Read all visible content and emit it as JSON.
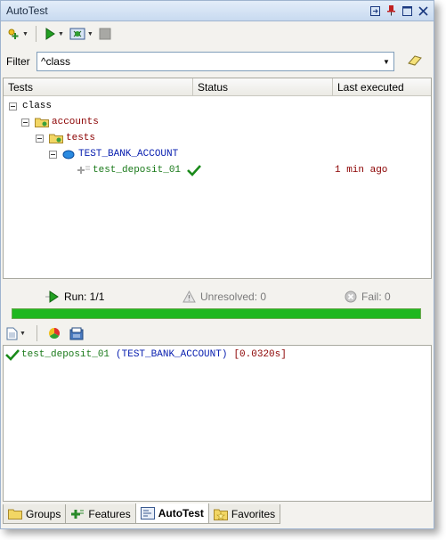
{
  "window": {
    "title": "AutoTest"
  },
  "filter": {
    "label": "Filter",
    "value": "^class"
  },
  "tree": {
    "columns": [
      "Tests",
      "Status",
      "Last executed"
    ],
    "rows": [
      {
        "label": "class"
      },
      {
        "label": "accounts"
      },
      {
        "label": "tests"
      },
      {
        "label": "TEST_BANK_ACCOUNT"
      },
      {
        "label": "test_deposit_01",
        "last_executed": "1 min ago"
      }
    ]
  },
  "summary": {
    "run": "Run: 1/1",
    "unresolved": "Unresolved: 0",
    "fail": "Fail: 0",
    "progress": 1.0
  },
  "output": {
    "test": "test_deposit_01",
    "class": "(TEST_BANK_ACCOUNT)",
    "time": "[0.0320s]"
  },
  "tabs": [
    {
      "label": "Groups",
      "icon": "folder-icon"
    },
    {
      "label": "Features",
      "icon": "features-icon"
    },
    {
      "label": "AutoTest",
      "icon": "autotest-icon",
      "active": true
    },
    {
      "label": "Favorites",
      "icon": "star-folder-icon"
    }
  ],
  "colors": {
    "progress": "#1fb71f",
    "class_text": "#8b0000",
    "test_text": "#1a7a1a",
    "feature_text": "#0a20b0"
  }
}
